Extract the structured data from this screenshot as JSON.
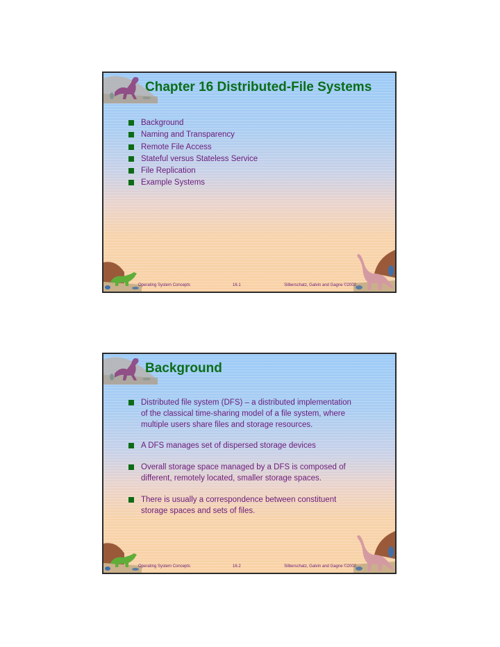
{
  "slides": [
    {
      "title": "Chapter 16  Distributed-File Systems",
      "bullets": [
        "Background",
        "Naming and Transparency",
        "Remote File Access",
        "Stateful versus Stateless Service",
        "File Replication",
        "Example Systems"
      ],
      "footer": {
        "left": "Operating System Concepts",
        "center": "16.1",
        "right": "Silberschatz, Galvin and  Gagne ©2002"
      }
    },
    {
      "title": "Background",
      "bullets": [
        "Distributed file system (DFS) – a distributed implementation of the classical time-sharing model of a file system, where multiple users share files and storage resources.",
        "A DFS manages set of dispersed storage devices",
        "Overall storage space managed by a DFS is composed of different, remotely located, smaller storage spaces.",
        "There is usually a correspondence between constituent storage spaces and sets of files."
      ],
      "footer": {
        "left": "Operating System Concepts",
        "center": "16.2",
        "right": "Silberschatz, Galvin and  Gagne ©2002"
      }
    }
  ],
  "icons": {
    "top_left": "purple-dinosaur-icon",
    "bottom_left": "green-triceratops-icon",
    "bottom_right": "pink-brontosaurus-icon"
  },
  "colors": {
    "title": "#0b6d18",
    "text": "#6a1b7a",
    "bullet": "#0d6a16",
    "sky": "#9ccbf7",
    "sand": "#f9d2a6"
  }
}
